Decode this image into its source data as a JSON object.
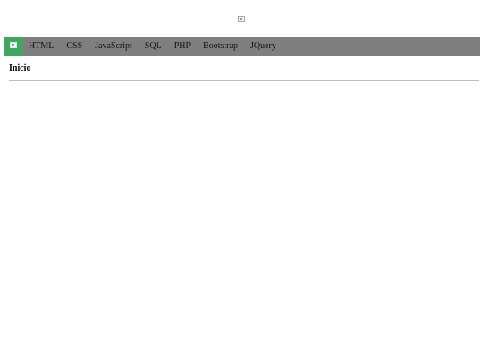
{
  "header": {
    "logo_alt": ""
  },
  "navbar": {
    "home_icon": "broken-image-icon",
    "home_color": "#3fa760",
    "background_color": "#7f7f7f",
    "items": [
      {
        "label": "HTML"
      },
      {
        "label": "CSS"
      },
      {
        "label": "JavaScript"
      },
      {
        "label": "SQL"
      },
      {
        "label": "PHP"
      },
      {
        "label": "Bootstrap"
      },
      {
        "label": "JQuery"
      }
    ]
  },
  "main": {
    "title": "Inicio"
  }
}
